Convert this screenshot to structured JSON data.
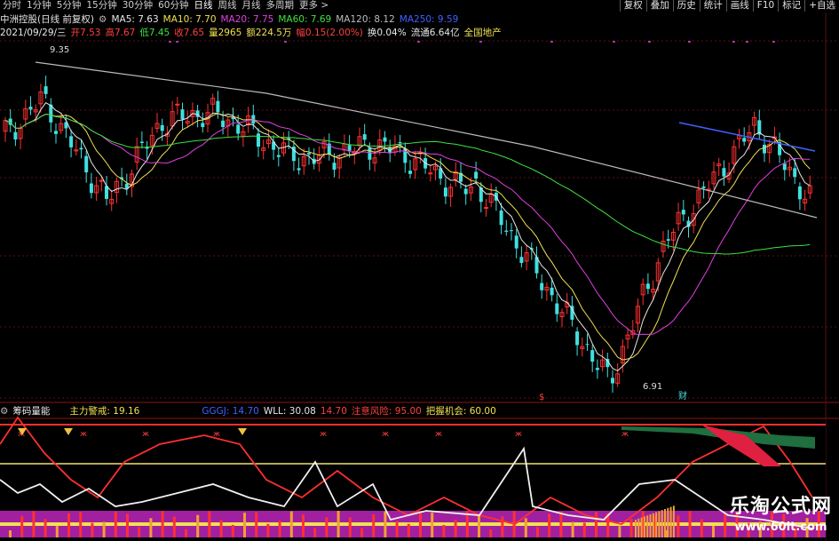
{
  "toolbar": {
    "periods": [
      "分时",
      "1分钟",
      "5分钟",
      "15分钟",
      "30分钟",
      "60分钟",
      "日线",
      "周线",
      "月线",
      "多周期",
      "更多 >"
    ],
    "active": "日线",
    "right_buttons": [
      "复权",
      "叠加",
      "历史",
      "统计",
      "画线",
      "F10",
      "标记",
      "+自选"
    ]
  },
  "stock": {
    "title": "中洲控股(日线 前复权)",
    "ma5": "MA5: 7.63",
    "ma10": "MA10: 7.70",
    "ma20": "MA20: 7.75",
    "ma60": "MA60: 7.69",
    "ma120": "MA120: 8.12",
    "ma250": "MA250: 9.59",
    "date": "2021/09/29/三",
    "open": "开7.53",
    "high": "高7.67",
    "low": "低7.45",
    "close": "收7.65",
    "vol": "量2965",
    "amount": "额224.5万",
    "change": "幅0.15(2.00%)",
    "turnover": "换0.04%",
    "float": "流通6.64亿",
    "sector": "全国地产"
  },
  "chart": {
    "high_label": "9.35",
    "low_label": "6.91",
    "marker_s": "$",
    "marker_cai": "财"
  },
  "indicator": {
    "name": "筹码量能",
    "main_alert": "主力警戒: 19.16",
    "var1": "GGGJ: 14.70",
    "wll": "WLL: 30.08",
    "v2": "14.70",
    "risk": "注意风险: 95.00",
    "chance": "把握机会: 60.00"
  },
  "watermark": {
    "line1": "乐淘公式网",
    "line2": "www.60lt.com"
  },
  "colors": {
    "up": "#ff3030",
    "down": "#40e0e0",
    "ma5": "#e6e6e6",
    "ma10": "#f0e050",
    "ma20": "#e040e0",
    "ma60": "#40e040",
    "ma120": "#bbbbbb",
    "ma250": "#4060ff"
  }
}
